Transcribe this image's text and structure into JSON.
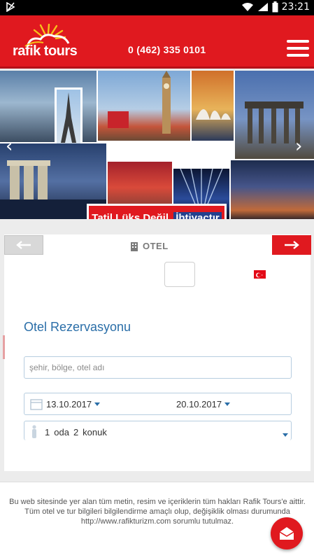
{
  "status_bar": {
    "time": "23:21"
  },
  "header": {
    "logo_text": "rafik tours",
    "phone": "0 (462) 335 0101",
    "menu_icon": "hamburger-icon"
  },
  "banner": {
    "slogan_part1": "Tatil Lüks Değil,",
    "slogan_part2": "İhtiyaçtır"
  },
  "search_panel": {
    "tab_label": "OTEL",
    "title": "Otel Rezervasyonu",
    "search_placeholder": "şehir, bölge, otel adı",
    "checkin": "13.10.2017",
    "checkout": "20.10.2017",
    "rooms_count": "1",
    "rooms_label": "oda",
    "guests_count": "2",
    "guests_label": "konuk"
  },
  "footer": {
    "notice": "Bu web sitesinde yer alan tüm metin, resim ve içeriklerin tüm hakları Rafik Tours'e aittir. Tüm otel ve tur bilgileri bilgilendirme amaçlı olup, değişiklik olması durumunda http://www.rafikturizm.com sorumlu tutulmaz."
  },
  "colors": {
    "brand_red": "#e0191f",
    "link_blue": "#2a6ea8"
  }
}
